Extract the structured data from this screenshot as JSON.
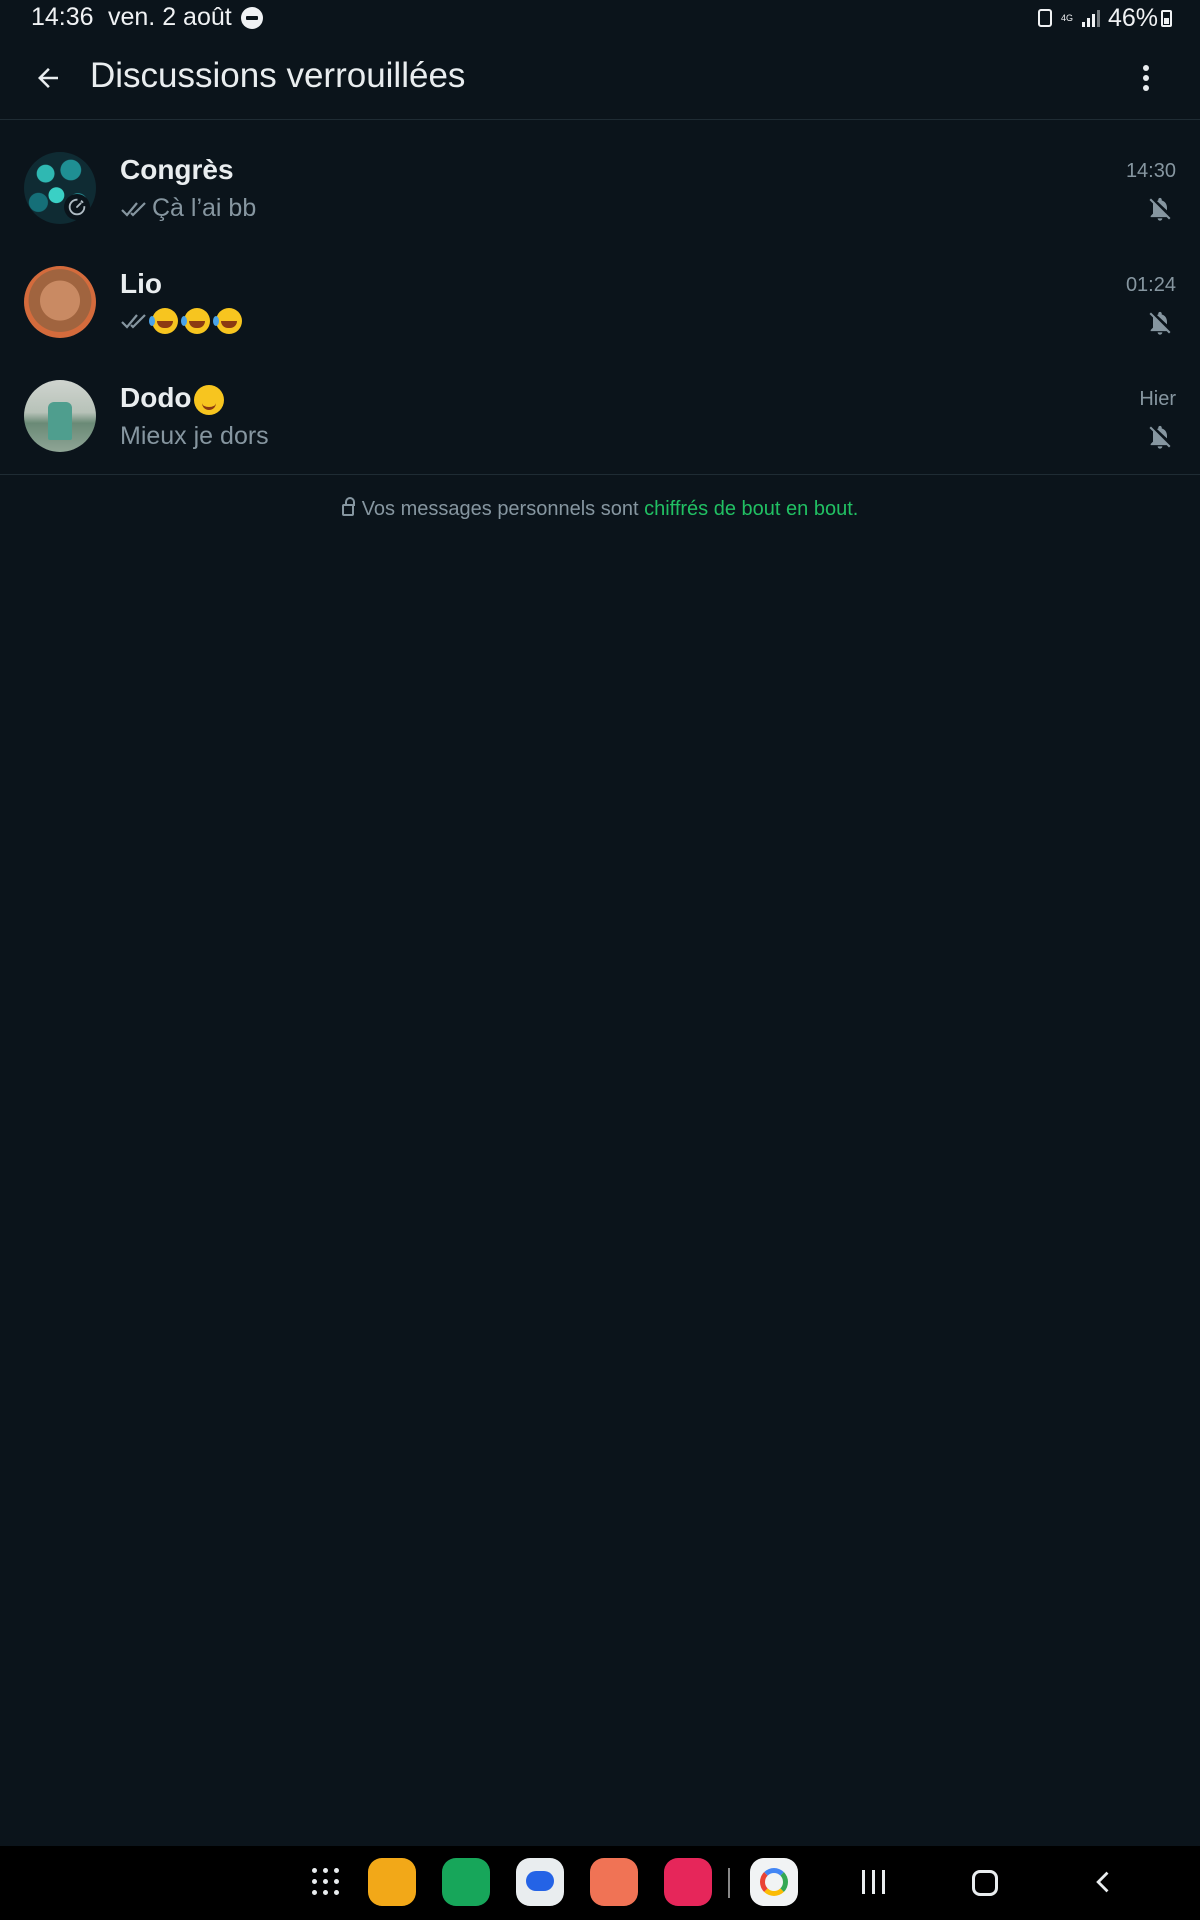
{
  "status_bar": {
    "time": "14:36",
    "date": "ven. 2 août",
    "network": "4G",
    "battery": "46%"
  },
  "app_bar": {
    "title": "Discussions verrouillées",
    "back_icon": "arrow-left-icon",
    "menu_icon": "more-vert-icon"
  },
  "chats": [
    {
      "name": "Congrès",
      "preview": "Çà l’ai bb",
      "time": "14:30",
      "read_ticks": true,
      "muted": true,
      "disappearing_timer": true
    },
    {
      "name": "Lio",
      "preview": "",
      "preview_emojis": [
        "rolling-laughing",
        "rolling-laughing",
        "rolling-laughing"
      ],
      "time": "01:24",
      "read_ticks": true,
      "muted": true
    },
    {
      "name": "Dodo",
      "name_emoji": "smiling-blush",
      "preview": "Mieux je dors",
      "time": "Hier",
      "read_ticks": false,
      "muted": true
    }
  ],
  "encryption_note": {
    "text": "Vos messages personnels sont ",
    "link": "chiffrés de bout en bout",
    "suffix": "."
  },
  "dock": [
    "files-app",
    "phone-app",
    "messages-app",
    "contacts-app",
    "camera-app",
    "google-app"
  ],
  "colors": {
    "background": "#0b141b",
    "accent": "#21c063",
    "secondary_text": "#8696a0"
  }
}
